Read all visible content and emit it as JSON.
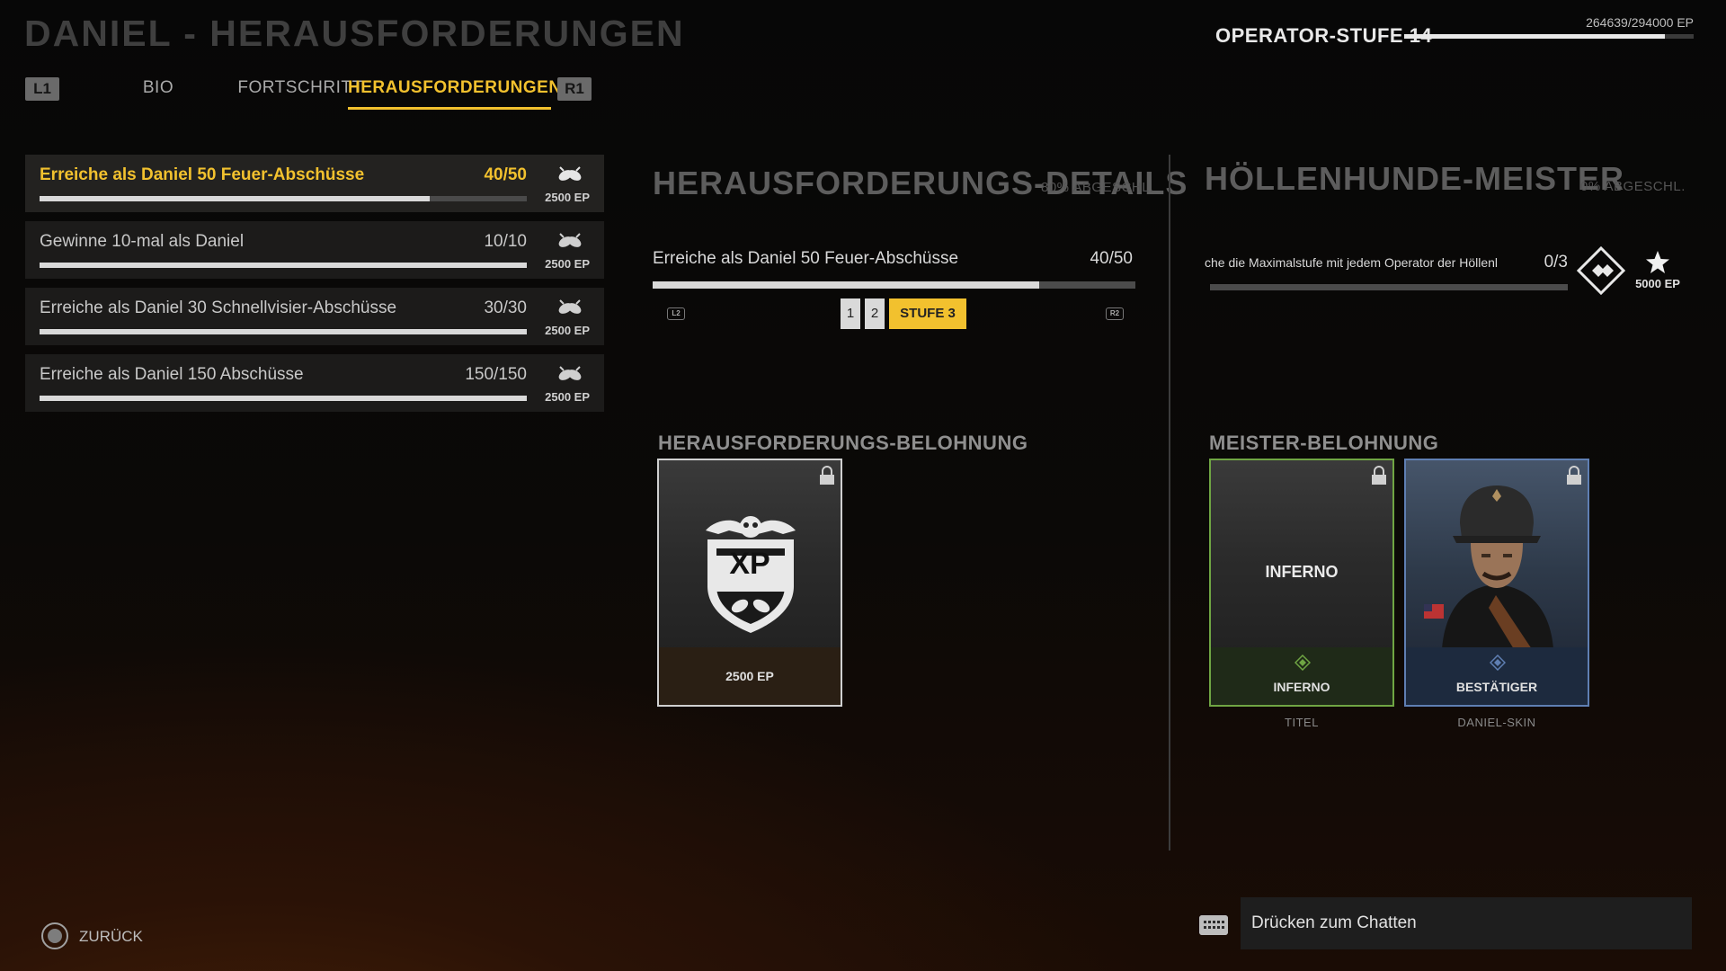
{
  "header": {
    "title": "DANIEL - HERAUSFORDERUNGEN",
    "tabs": [
      {
        "badge": "L1"
      },
      {
        "label": "BIO"
      },
      {
        "label": "FORTSCHRITT"
      },
      {
        "label": "HERAUSFORDERUNGEN",
        "active": true
      },
      {
        "badge": "R1"
      }
    ]
  },
  "operator": {
    "label": "OPERATOR-STUFE 14",
    "xp_text": "264639/294000 EP",
    "progress": 0.9
  },
  "challenges": [
    {
      "label": "Erreiche als Daniel 50 Feuer-Abschüsse",
      "count": "40/50",
      "progress": 0.8,
      "reward": "2500 EP",
      "icon": "bombs-icon",
      "active": true
    },
    {
      "label": "Gewinne 10-mal als Daniel",
      "count": "10/10",
      "progress": 1.0,
      "reward": "2500 EP",
      "icon": "bombs-icon"
    },
    {
      "label": "Erreiche als Daniel 30 Schnellvisier-Abschüsse",
      "count": "30/30",
      "progress": 1.0,
      "reward": "2500 EP",
      "icon": "bombs-icon"
    },
    {
      "label": "Erreiche als Daniel 150 Abschüsse",
      "count": "150/150",
      "progress": 1.0,
      "reward": "2500 EP",
      "icon": "bombs-icon"
    }
  ],
  "details": {
    "title": "HERAUSFORDERUNGS-DETAILS",
    "sub": "80% ABGESCHL.",
    "label": "Erreiche als Daniel 50 Feuer-Abschüsse",
    "count": "40/50",
    "progress": 0.8,
    "left_shoulder": "L2",
    "right_shoulder": "R2",
    "tiers": [
      "1",
      "2",
      "STUFE 3"
    ],
    "reward_heading": "HERAUSFORDERUNGS-BELOHNUNG",
    "reward": {
      "label": "2500 EP",
      "emblem_text": "XP"
    }
  },
  "master": {
    "title": "HÖLLENHUNDE-MEISTER",
    "sub": "0% ABGESCHL.",
    "label": "che die Maximalstufe mit jedem Operator der Höllenl",
    "count": "0/3",
    "progress": 0,
    "reward_xp": "5000 EP",
    "reward_heading": "MEISTER-BELOHNUNG",
    "rewards": [
      {
        "center_text": "INFERNO",
        "label": "INFERNO",
        "type": "TITEL",
        "color": "#6fa543"
      },
      {
        "label": "BESTÄTIGER",
        "type": "DANIEL-SKIN",
        "color": "#5f7fb3"
      }
    ]
  },
  "footer": {
    "back_label": "ZURÜCK",
    "chat_label": "Drücken zum Chatten"
  }
}
